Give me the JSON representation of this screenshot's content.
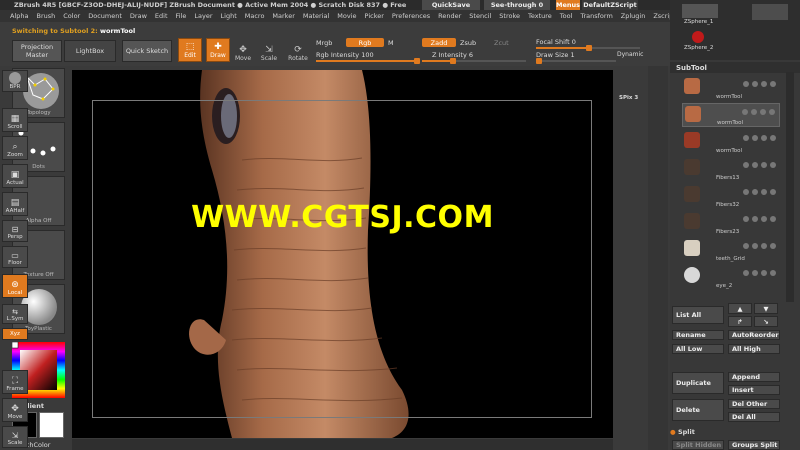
{
  "title_bar": {
    "text": "ZBrush 4R5 [GBCF-Z3OD-DHEJ-ALIJ-NUDF]   ZBrush Document   ● Active Mem 2004 ● Scratch Disk 837 ● Free",
    "quicksave": "QuickSave",
    "see_through": "See-through  0",
    "menus": "Menus",
    "script": "DefaultZScript"
  },
  "menu_items": [
    "Alpha",
    "Brush",
    "Color",
    "Document",
    "Draw",
    "Edit",
    "File",
    "Layer",
    "Light",
    "Macro",
    "Marker",
    "Material",
    "Movie",
    "Picker",
    "Preferences",
    "Render",
    "Stencil",
    "Stroke",
    "Texture",
    "Tool",
    "Transform",
    "Zplugin",
    "Zscript"
  ],
  "toolbar": {
    "status_prefix": "Switching to Subtool 2:",
    "status_tool": "wormTool",
    "projection_master": "Projection Master",
    "lightbox": "LightBox",
    "quick_sketch": "Quick Sketch",
    "edit": "Edit",
    "draw": "Draw",
    "move": "Move",
    "scale": "Scale",
    "rotate": "Rotate",
    "mrgb": "Mrgb",
    "rgb": "Rgb",
    "m": "M",
    "zadd": "Zadd",
    "zsub": "Zsub",
    "zcut": "Zcut",
    "rgb_intensity": "Rgb Intensity 100",
    "z_intensity": "Z Intensity 6",
    "focal_shift": "Focal Shift 0",
    "draw_size": "Draw Size 1",
    "dynamic": "Dynamic"
  },
  "left_panel": {
    "topology": "Topology",
    "dots": "Dots",
    "alpha_off": "Alpha Off",
    "texture_off": "Texture Off",
    "material": "ToyPlastic",
    "gradient": "Gradient",
    "switch_color": "SwitchColor"
  },
  "canvas": {
    "watermark": "WWW.CGTSJ.COM"
  },
  "right_dock": {
    "bpr": "BPR",
    "spix": "SPix 3",
    "scroll": "Scroll",
    "zoom": "Zoom",
    "actual": "Actual",
    "aahalf": "AAHalf",
    "persp": "Persp",
    "floor": "Floor",
    "local": "Local",
    "lsym": "L.Sym",
    "xyz": "Xyz",
    "frame": "Frame",
    "move": "Move",
    "scale": "Scale"
  },
  "tool_panel": {
    "top_items": [
      "ZSphere_1",
      "ZSphere_2"
    ],
    "subtool_title": "SubTool",
    "subtools": [
      "wormTool",
      "wormTool",
      "wormTool",
      "Fibers13",
      "Fibers32",
      "Fibers23",
      "teeth_Grid",
      "eye_2"
    ],
    "list_all": "List All",
    "rename": "Rename",
    "auto_reorder": "AutoReorder",
    "all_low": "All Low",
    "all_high": "All High",
    "duplicate": "Duplicate",
    "append": "Append",
    "insert": "Insert",
    "delete": "Delete",
    "del_other": "Del Other",
    "del_all": "Del All",
    "split": "Split",
    "split_hidden": "Split Hidden",
    "groups_split": "Groups Split"
  },
  "colors": {
    "accent": "#e07a1f",
    "watermark": "#ffff00",
    "panel": "#3a3a3a"
  }
}
